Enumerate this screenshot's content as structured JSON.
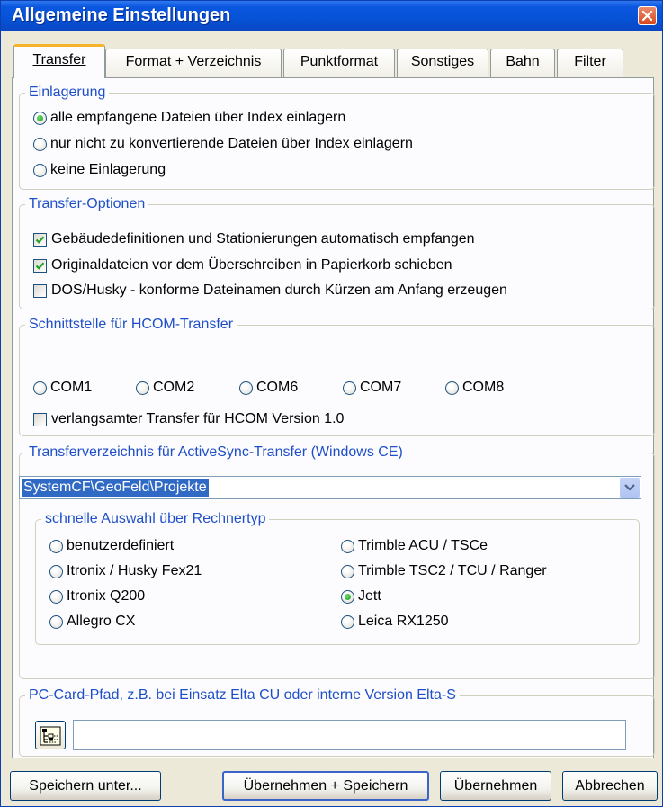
{
  "window": {
    "title": "Allgemeine Einstellungen",
    "close_icon": "close-icon"
  },
  "tabs": [
    {
      "label": "Transfer",
      "active": true
    },
    {
      "label": "Format + Verzeichnis",
      "active": false
    },
    {
      "label": "Punktformat",
      "active": false
    },
    {
      "label": "Sonstiges",
      "active": false
    },
    {
      "label": "Bahn",
      "active": false
    },
    {
      "label": "Filter",
      "active": false
    }
  ],
  "einlagerung": {
    "legend": "Einlagerung",
    "options": [
      {
        "label": "alle empfangene Dateien über Index einlagern",
        "selected": true
      },
      {
        "label": "nur nicht zu konvertierende Dateien über Index einlagern",
        "selected": false
      },
      {
        "label": "keine Einlagerung",
        "selected": false
      }
    ]
  },
  "transfer_optionen": {
    "legend": "Transfer-Optionen",
    "checks": [
      {
        "label": "Gebäudedefinitionen und Stationierungen automatisch empfangen",
        "checked": true
      },
      {
        "label": "Originaldateien vor dem Überschreiben in Papierkorb schieben",
        "checked": true
      },
      {
        "label": "DOS/Husky - konforme Dateinamen durch Kürzen am Anfang erzeugen",
        "checked": false
      }
    ]
  },
  "hcom": {
    "legend": "Schnittstelle für HCOM-Transfer",
    "ports": [
      "COM1",
      "COM2",
      "COM6",
      "COM7",
      "COM8"
    ],
    "slow_transfer": {
      "label": "verlangsamter Transfer für HCOM Version 1.0",
      "checked": false
    }
  },
  "activesync": {
    "legend": "Transferverzeichnis für ActiveSync-Transfer (Windows CE)",
    "path": "SystemCF\\GeoFeld\\Projekte",
    "quick_select": {
      "legend": "schnelle Auswahl über Rechnertyp",
      "left": [
        {
          "label": "benutzerdefiniert",
          "selected": false
        },
        {
          "label": "Itronix / Husky Fex21",
          "selected": false
        },
        {
          "label": "Itronix Q200",
          "selected": false
        },
        {
          "label": "Allegro CX",
          "selected": false
        }
      ],
      "right": [
        {
          "label": "Trimble ACU / TSCe",
          "selected": false
        },
        {
          "label": "Trimble TSC2 / TCU / Ranger",
          "selected": false
        },
        {
          "label": "Jett",
          "selected": true
        },
        {
          "label": "Leica RX1250",
          "selected": false
        }
      ]
    }
  },
  "pccard": {
    "legend": "PC-Card-Pfad, z.B. bei Einsatz Elta CU oder interne Version Elta-S",
    "value": "",
    "browse_icon": "folder-tree-icon"
  },
  "buttons": {
    "save_as": "Speichern unter...",
    "apply_save": "Übernehmen + Speichern",
    "apply": "Übernehmen",
    "cancel": "Abbrechen"
  }
}
